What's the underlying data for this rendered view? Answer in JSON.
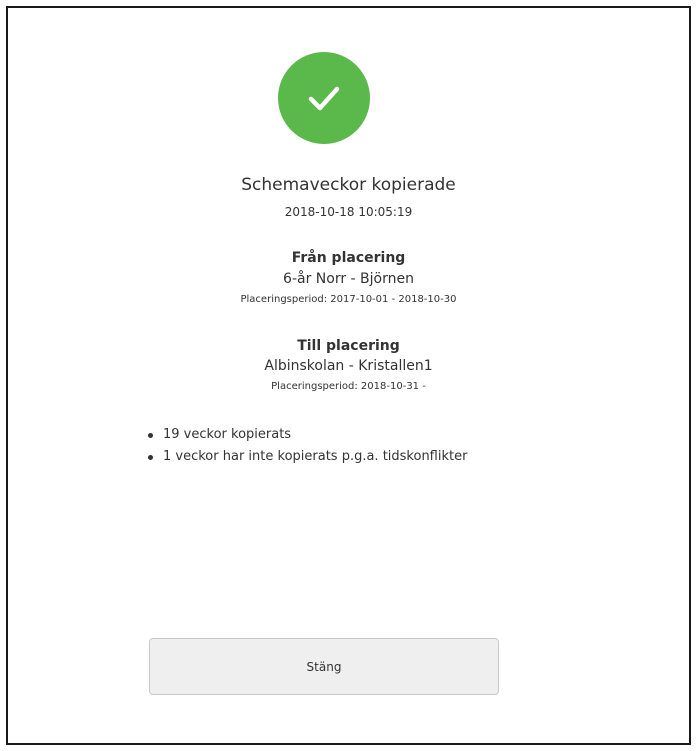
{
  "dialog": {
    "icon": "checkmark-icon",
    "title": "Schemaveckor kopierade",
    "timestamp": "2018-10-18 10:05:19",
    "from": {
      "heading": "Från placering",
      "name": "6-år Norr - Björnen",
      "period": "Placeringsperiod: 2017-10-01 - 2018-10-30"
    },
    "to": {
      "heading": "Till placering",
      "name": "Albinskolan - Kristallen1",
      "period": "Placeringsperiod: 2018-10-31 -"
    },
    "results": [
      "19 veckor kopierats",
      "1 veckor har inte kopierats p.g.a. tidskonflikter"
    ],
    "close_label": "Stäng"
  },
  "colors": {
    "success": "#5bb84a",
    "border": "#1a1a1a",
    "button_bg": "#efefef"
  }
}
